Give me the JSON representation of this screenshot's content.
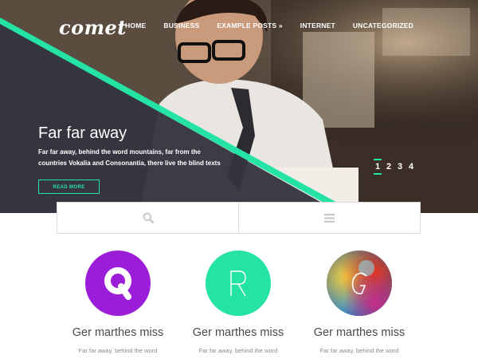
{
  "brand": {
    "logo_text": "comet"
  },
  "nav": {
    "items": [
      {
        "label": "HOME"
      },
      {
        "label": "BUSINESS"
      },
      {
        "label": "EXAMPLE POSTS »"
      },
      {
        "label": "INTERNET"
      },
      {
        "label": "UNCATEGORIZED"
      }
    ]
  },
  "hero": {
    "title": "Far far away",
    "text": "Far far away, behind the word mountains, far from the countries Vokalia and Consonantia, there live the blind texts",
    "button_label": "READ MORE",
    "pager": [
      "1",
      "2",
      "3",
      "4"
    ],
    "active_page": 1
  },
  "toolbar": {
    "left_icon": "search-icon",
    "right_icon": "menu-icon"
  },
  "features": [
    {
      "letter": "Q",
      "title": "Ger marthes miss",
      "text": "Far far away, behind the word",
      "color": "#9b1dd8"
    },
    {
      "letter": "R",
      "title": "Ger marthes miss",
      "text": "Far far away, behind the word",
      "color": "#24e3a5"
    },
    {
      "letter": "G",
      "title": "Ger marthes miss",
      "text": "Far far away, behind the word",
      "color": "#c0392b"
    }
  ],
  "colors": {
    "accent": "#24e3a5",
    "dark_panel": "#34343f",
    "purple": "#9b1dd8"
  }
}
